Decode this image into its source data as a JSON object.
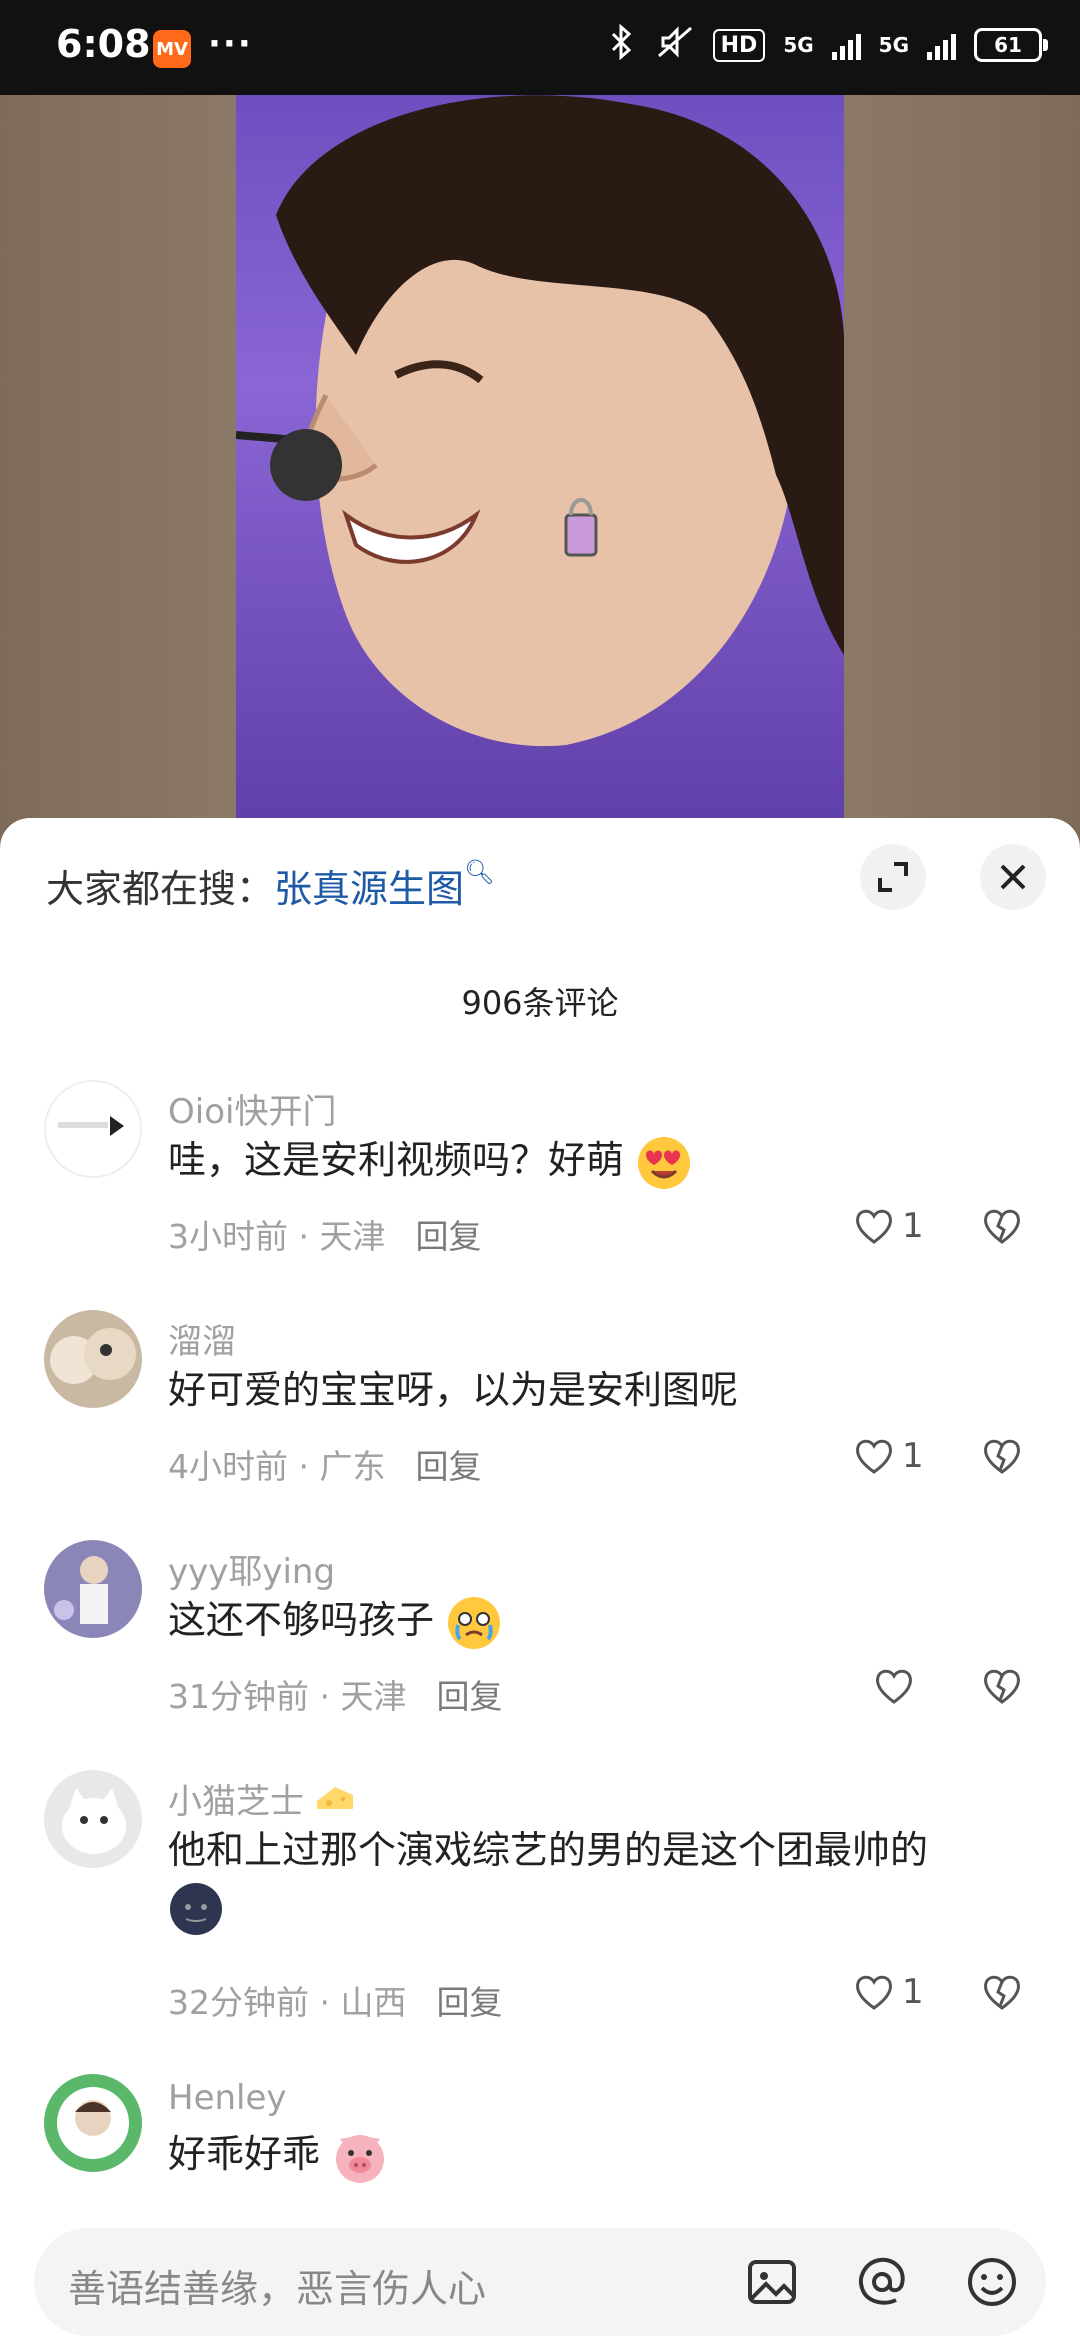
{
  "status_bar": {
    "time": "6:08",
    "app_badge": "MV",
    "more": "···",
    "hd_label": "HD",
    "net1": "5G",
    "net2": "5G",
    "battery": "61"
  },
  "sheet": {
    "search_prefix": "大家都在搜：",
    "search_term": "张真源生图",
    "comment_count": "906条评论"
  },
  "comments": [
    {
      "user": "Oioi快开门",
      "text": "哇，这是安利视频吗？好萌",
      "emoji": "heart-eyes-face",
      "time": "3小时前",
      "location": "天津",
      "reply": "回复",
      "likes": "1"
    },
    {
      "user": "溜溜",
      "text": "好可爱的宝宝呀，以为是安利图呢",
      "time": "4小时前",
      "location": "广东",
      "reply": "回复",
      "likes": "1"
    },
    {
      "user": "yyy耶ying",
      "text": "这还不够吗孩子",
      "emoji": "crying-face",
      "time": "31分钟前",
      "location": "天津",
      "reply": "回复",
      "likes": ""
    },
    {
      "user": "小猫芝士",
      "text": "他和上过那个演戏综艺的男的是这个团最帅的",
      "emoji": "dark-face",
      "time": "32分钟前",
      "location": "山西",
      "reply": "回复",
      "likes": "1"
    },
    {
      "user": "Henley",
      "text": "好乖好乖",
      "emoji": "pig-face"
    }
  ],
  "input": {
    "placeholder": "善语结善缘，恶言伤人心"
  },
  "colors": {
    "accent_blue": "#1f5aa6",
    "meta_gray": "#a0a0a0"
  }
}
